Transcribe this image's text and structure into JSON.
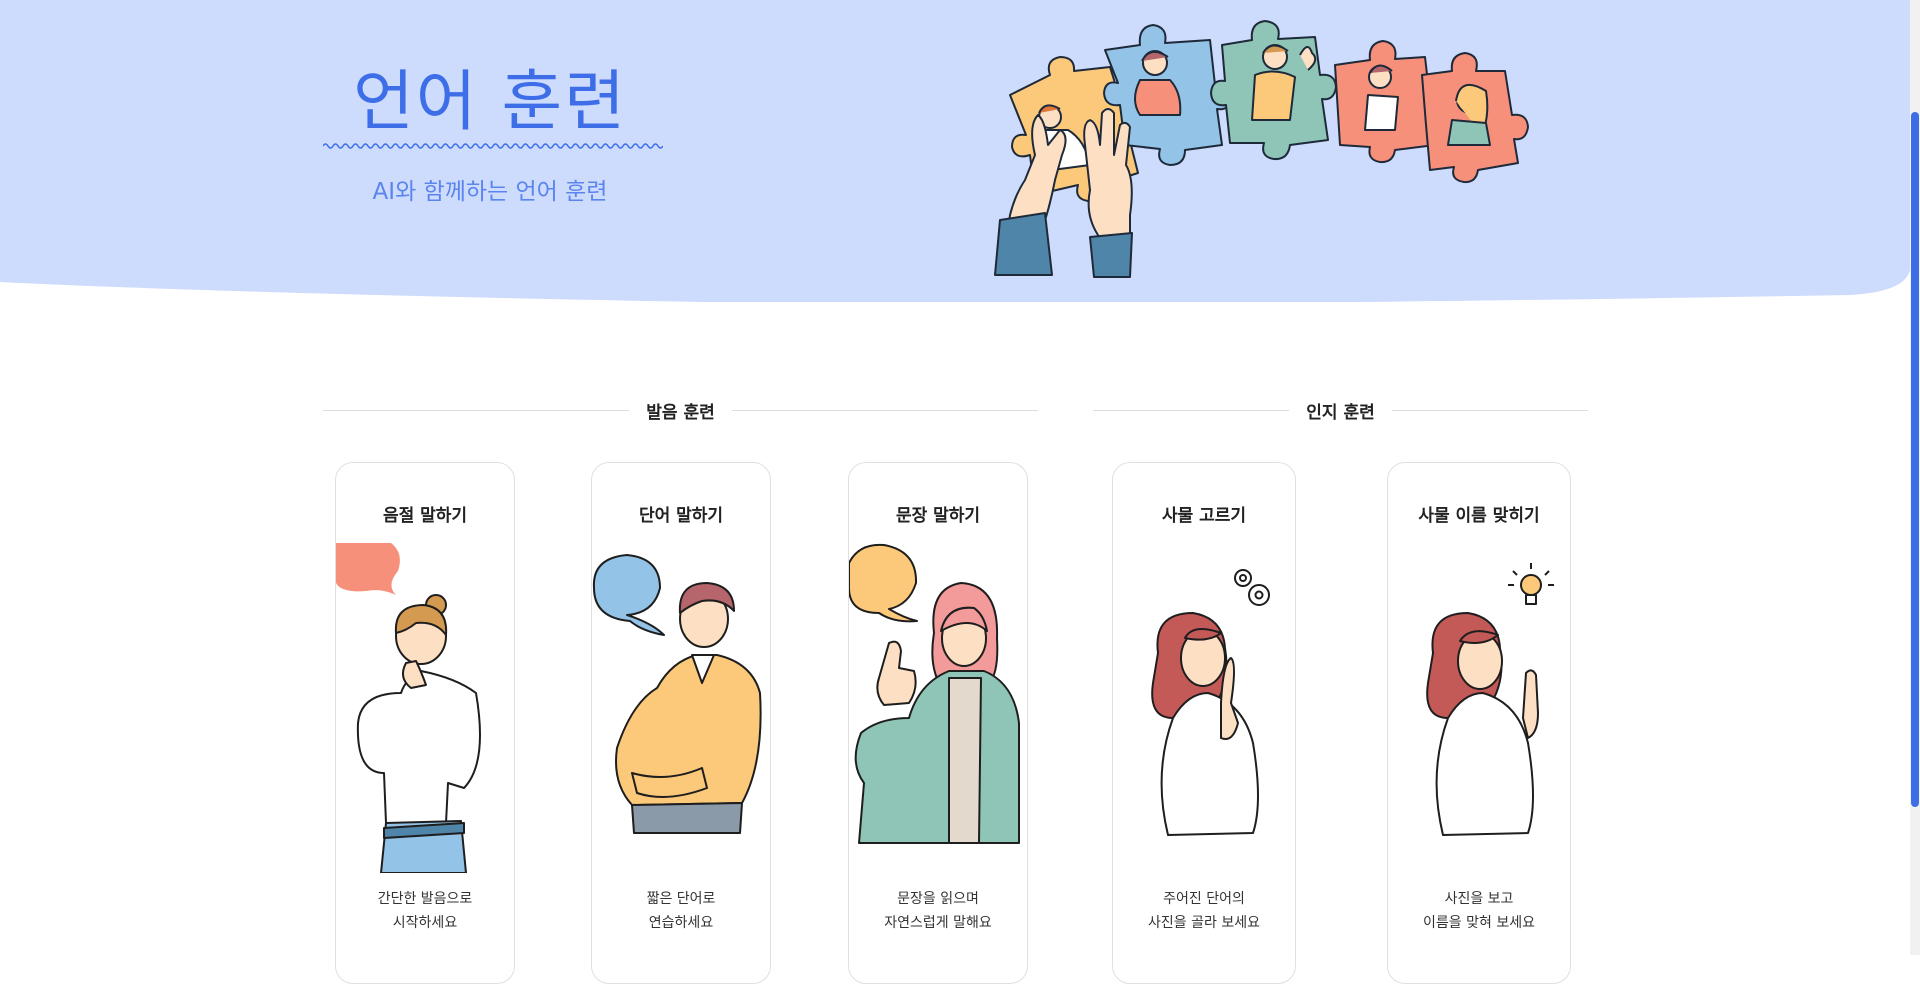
{
  "hero": {
    "title": "언어 훈련",
    "subtitle": "AI와 함께하는 언어 훈련"
  },
  "sections": [
    {
      "label": "발음 훈련"
    },
    {
      "label": "인지 훈련"
    }
  ],
  "cards": [
    {
      "title": "음절 말하기",
      "desc_line1": "간단한 발음으로",
      "desc_line2": "시작하세요",
      "bubble_color": "#f7907a"
    },
    {
      "title": "단어 말하기",
      "desc_line1": "짧은 단어로",
      "desc_line2": "연습하세요",
      "bubble_color": "#93c3e6"
    },
    {
      "title": "문장 말하기",
      "desc_line1": "문장을 읽으며",
      "desc_line2": "자연스럽게 말해요",
      "bubble_color": "#fcc97a"
    },
    {
      "title": "사물 고르기",
      "desc_line1": "주어진 단어의",
      "desc_line2": "사진을 골라 보세요"
    },
    {
      "title": "사물 이름 맞히기",
      "desc_line1": "사진을 보고",
      "desc_line2": "이름을 맞혀 보세요"
    }
  ],
  "colors": {
    "hero_bg": "#cddbfd",
    "accent": "#3d6ee8"
  }
}
